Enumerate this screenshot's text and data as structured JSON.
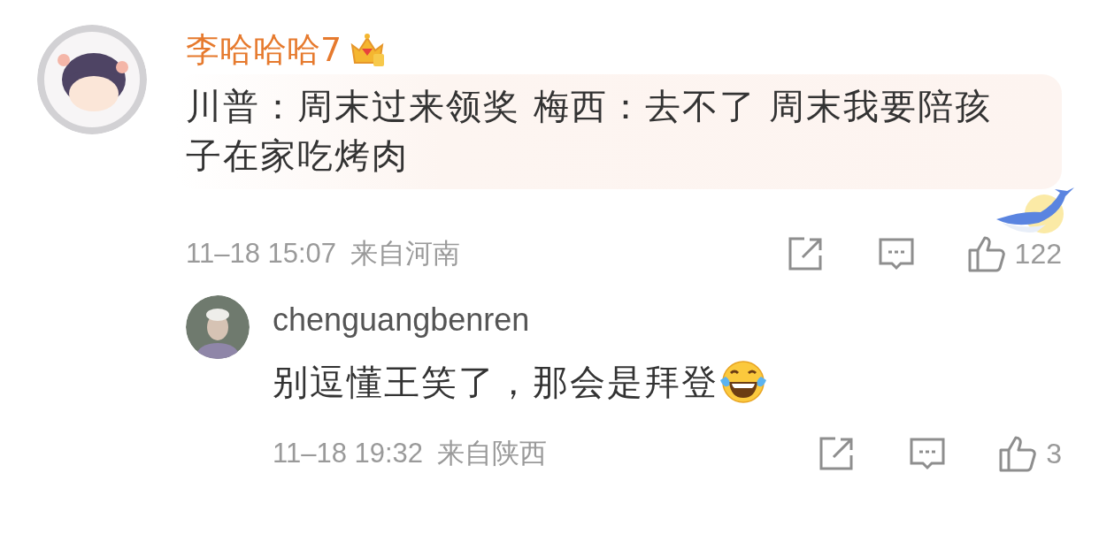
{
  "comment": {
    "author": "李哈哈哈7",
    "text": "川普：周末过来领奖 梅西：去不了 周末我要陪孩子在家吃烤肉",
    "time": "11–18 15:07",
    "location": "来自河南",
    "likes": "122"
  },
  "reply": {
    "author": "chenguangbenren",
    "text": "别逗懂王笑了，那会是拜登",
    "time": "11–18 19:32",
    "location": "来自陕西",
    "likes": "3"
  }
}
